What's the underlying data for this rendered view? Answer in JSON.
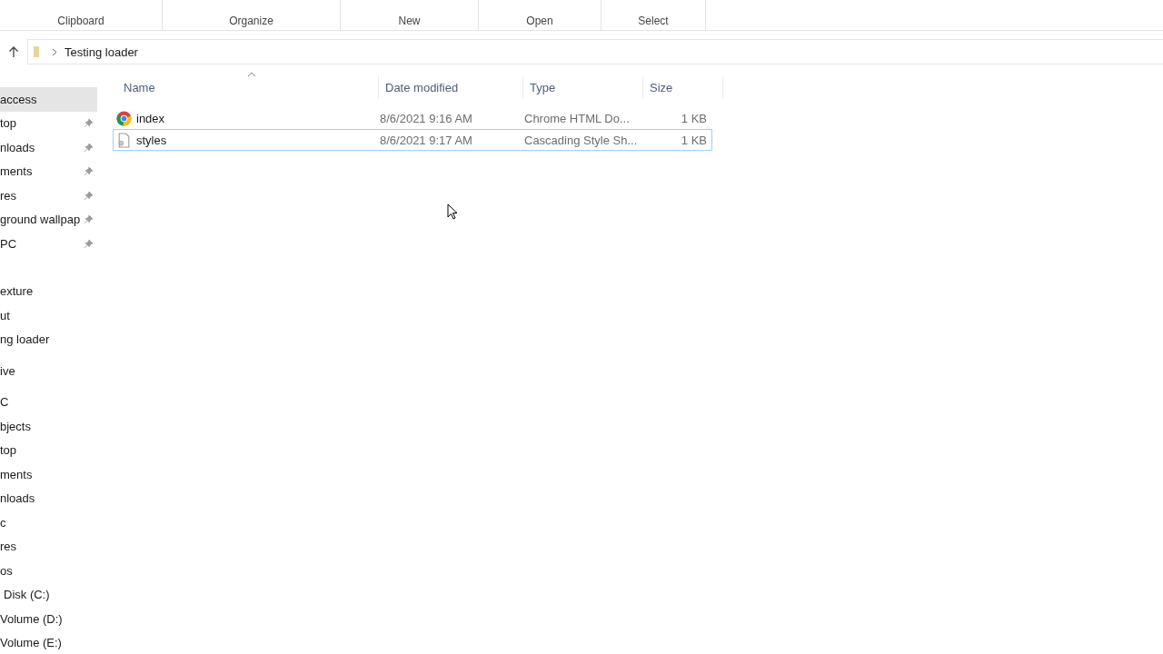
{
  "ribbon": {
    "groups": [
      {
        "label": "Clipboard"
      },
      {
        "label": "Organize"
      },
      {
        "label": "New"
      },
      {
        "label": "Open"
      },
      {
        "label": "Select"
      }
    ]
  },
  "address_bar": {
    "path": [
      "Testing loader"
    ]
  },
  "navigation": {
    "sections": [
      {
        "items": [
          {
            "label": "access",
            "selected": true,
            "pinned": false
          },
          {
            "label": "top",
            "selected": false,
            "pinned": true
          },
          {
            "label": "nloads",
            "selected": false,
            "pinned": true
          },
          {
            "label": "ments",
            "selected": false,
            "pinned": true
          },
          {
            "label": "res",
            "selected": false,
            "pinned": true
          },
          {
            "label": "ground wallpap",
            "selected": false,
            "pinned": true
          },
          {
            "label": "PC",
            "selected": false,
            "pinned": true
          }
        ]
      },
      {
        "items": [
          {
            "label": "exture",
            "selected": false,
            "pinned": false
          },
          {
            "label": "ut",
            "selected": false,
            "pinned": false
          },
          {
            "label": "ng loader",
            "selected": false,
            "pinned": false
          }
        ]
      },
      {
        "items": [
          {
            "label": "ive",
            "selected": false,
            "pinned": false
          }
        ]
      },
      {
        "items": [
          {
            "label": "C",
            "selected": false,
            "pinned": false
          },
          {
            "label": "bjects",
            "selected": false,
            "pinned": false
          },
          {
            "label": "top",
            "selected": false,
            "pinned": false
          },
          {
            "label": "ments",
            "selected": false,
            "pinned": false
          },
          {
            "label": "nloads",
            "selected": false,
            "pinned": false
          },
          {
            "label": "c",
            "selected": false,
            "pinned": false
          },
          {
            "label": "res",
            "selected": false,
            "pinned": false
          },
          {
            "label": "os",
            "selected": false,
            "pinned": false
          },
          {
            "label": "Disk (C:)",
            "selected": false,
            "pinned": false
          },
          {
            "label": "Volume (D:)",
            "selected": false,
            "pinned": false
          },
          {
            "label": "Volume (E:)",
            "selected": false,
            "pinned": false
          }
        ]
      }
    ]
  },
  "file_list": {
    "columns": [
      {
        "label": "Name",
        "sorted": true
      },
      {
        "label": "Date modified",
        "sorted": false
      },
      {
        "label": "Type",
        "sorted": false
      },
      {
        "label": "Size",
        "sorted": false
      }
    ],
    "rows": [
      {
        "kind": "browser-document",
        "name": "index",
        "date_modified": "8/6/2021 9:16 AM",
        "type": "Chrome HTML Do...",
        "size": "1 KB",
        "focused": false
      },
      {
        "kind": "stylesheet",
        "name": "styles",
        "date_modified": "8/6/2021 9:17 AM",
        "type": "Cascading Style Sh...",
        "size": "1 KB",
        "focused": true
      }
    ]
  }
}
